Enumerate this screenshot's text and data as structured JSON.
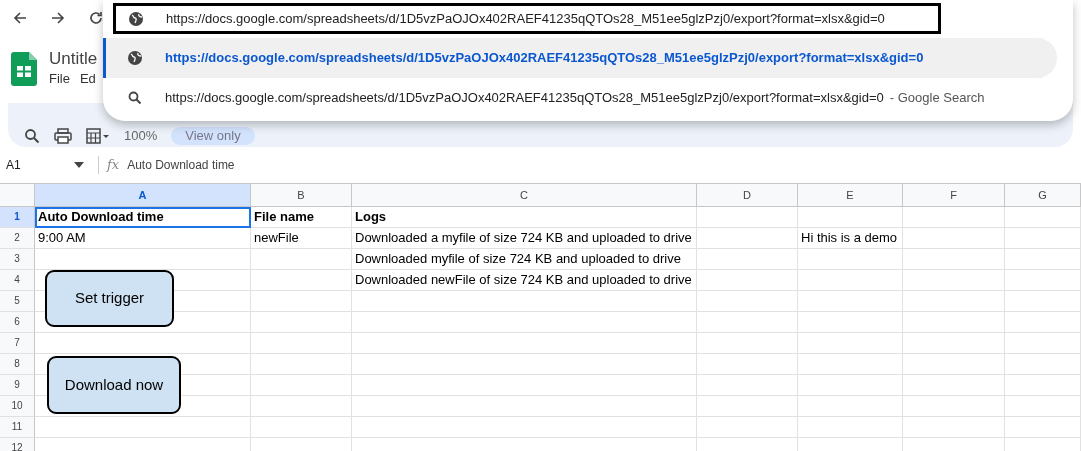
{
  "browser": {
    "address_bar": {
      "value": "https://docs.google.com/spreadsheets/d/1D5vzPaOJOx402RAEF41235qQTOs28_M51ee5glzPzj0/export?format=xlsx&gid=0"
    },
    "suggestions": [
      {
        "kind": "url",
        "text": "https://docs.google.com/spreadsheets/d/1D5vzPaOJOx402RAEF41235qQTOs28_M51ee5glzPzj0/export?format=xlsx&gid=0",
        "selected": true
      },
      {
        "kind": "search",
        "text": "https://docs.google.com/spreadsheets/d/1D5vzPaOJOx402RAEF41235qQTOs28_M51ee5glzPzj0/export?format=xlsx&gid=0",
        "suffix": "- Google Search",
        "selected": false
      }
    ]
  },
  "sheets": {
    "title": "Untitle",
    "menus": [
      "File",
      "Ed"
    ],
    "toolbar": {
      "zoom": "100%",
      "mode": "View only"
    }
  },
  "formula_bar": {
    "cell_ref": "A1",
    "function_label": "fx",
    "formula": "Auto Download time"
  },
  "grid": {
    "columns": [
      {
        "label": "A",
        "selected": true
      },
      {
        "label": "B",
        "selected": false
      },
      {
        "label": "C",
        "selected": false
      },
      {
        "label": "D",
        "selected": false
      },
      {
        "label": "E",
        "selected": false
      },
      {
        "label": "F",
        "selected": false
      },
      {
        "label": "G",
        "selected": false
      }
    ],
    "rows": [
      {
        "label": "1",
        "selected": true,
        "bold": true,
        "cells": [
          "Auto Download time",
          "File name",
          "Logs"
        ]
      },
      {
        "label": "2",
        "selected": false,
        "bold": false,
        "cells": [
          "9:00 AM",
          "newFile",
          "Downloaded a myfile of size 724 KB and uploaded to drive",
          "",
          "Hi this is a demo"
        ]
      },
      {
        "label": "3",
        "selected": false,
        "bold": false,
        "cells": [
          "",
          "",
          "Downloaded myfile of size 724 KB and uploaded to drive"
        ]
      },
      {
        "label": "4",
        "selected": false,
        "bold": false,
        "cells": [
          "",
          "",
          "Downloaded newFile of size 724 KB and uploaded to drive"
        ]
      },
      {
        "label": "5",
        "selected": false,
        "bold": false
      },
      {
        "label": "6",
        "selected": false,
        "bold": false
      },
      {
        "label": "7",
        "selected": false,
        "bold": false
      },
      {
        "label": "8",
        "selected": false,
        "bold": false
      },
      {
        "label": "9",
        "selected": false,
        "bold": false
      },
      {
        "label": "10",
        "selected": false,
        "bold": false
      },
      {
        "label": "11",
        "selected": false,
        "bold": false
      },
      {
        "label": "12",
        "selected": false,
        "bold": false
      }
    ]
  },
  "shapes": [
    {
      "text": "Set trigger"
    },
    {
      "text": "Download now"
    }
  ]
}
